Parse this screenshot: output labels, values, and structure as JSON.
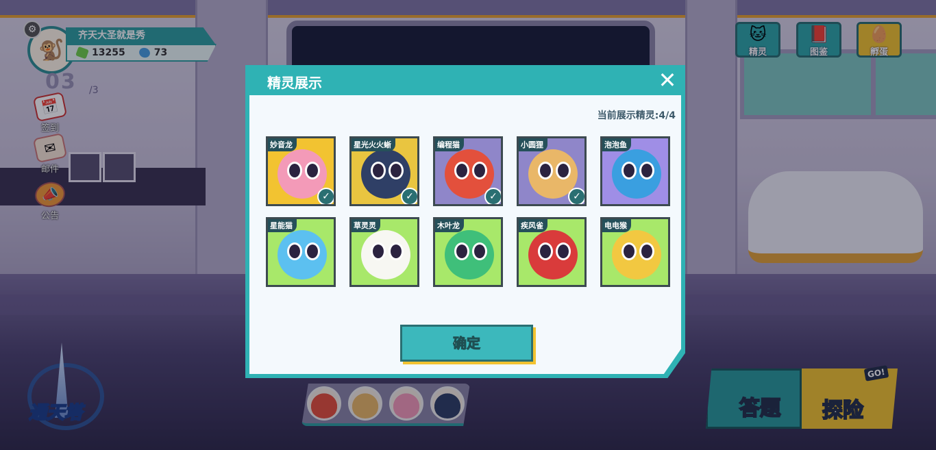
{
  "player": {
    "name": "齐天大圣就是秀",
    "green_gems": "13255",
    "blue_gems": "73",
    "floor_current": "03",
    "floor_max": "/3"
  },
  "side_buttons": [
    {
      "label": "签到",
      "icon": "calendar-icon"
    },
    {
      "label": "邮件",
      "icon": "mail-icon"
    },
    {
      "label": "公告",
      "icon": "megaphone-icon"
    }
  ],
  "top_buttons": [
    {
      "label": "精灵",
      "icon": "sprite-cat-icon"
    },
    {
      "label": "图鉴",
      "icon": "book-icon"
    },
    {
      "label": "孵蛋",
      "icon": "egg-icon"
    }
  ],
  "tower_label": "通天塔",
  "quiz_label": "答题",
  "explore_label": "探险",
  "go_badge": "GO!",
  "dialog": {
    "title": "精灵展示",
    "count_text": "当前展示精灵:4/4",
    "confirm_label": "确定",
    "sprites": [
      {
        "name": "妙音龙",
        "selected": true,
        "bg": "#f2c331",
        "face": "#f39ab8"
      },
      {
        "name": "星光火火蜥",
        "selected": true,
        "bg": "#e9c540",
        "face": "#2f3f66"
      },
      {
        "name": "编程猫",
        "selected": true,
        "bg": "#8f86c9",
        "face": "#e3503c"
      },
      {
        "name": "小圆狸",
        "selected": true,
        "bg": "#8f86c9",
        "face": "#e9b768"
      },
      {
        "name": "泡泡鱼",
        "selected": false,
        "bg": "#9f8ee6",
        "face": "#3a9fe0"
      },
      {
        "name": "星能猫",
        "selected": false,
        "bg": "#a8e86a",
        "face": "#5cc0f0"
      },
      {
        "name": "草灵灵",
        "selected": false,
        "bg": "#a8e86a",
        "face": "#f7f7f2"
      },
      {
        "name": "木叶龙",
        "selected": false,
        "bg": "#a8e86a",
        "face": "#3fbf7a"
      },
      {
        "name": "疾风雀",
        "selected": false,
        "bg": "#a8e86a",
        "face": "#d93b3b"
      },
      {
        "name": "电电猴",
        "selected": false,
        "bg": "#a8e86a",
        "face": "#f2c841"
      }
    ]
  },
  "bottom_pets": [
    {
      "icon": "sprite-red-ball-icon",
      "color": "#e3503c"
    },
    {
      "icon": "sprite-tan-ball-icon",
      "color": "#e9b768"
    },
    {
      "icon": "sprite-pink-ball-icon",
      "color": "#f39ab8"
    },
    {
      "icon": "sprite-dark-ball-icon",
      "color": "#2f3f66"
    }
  ]
}
